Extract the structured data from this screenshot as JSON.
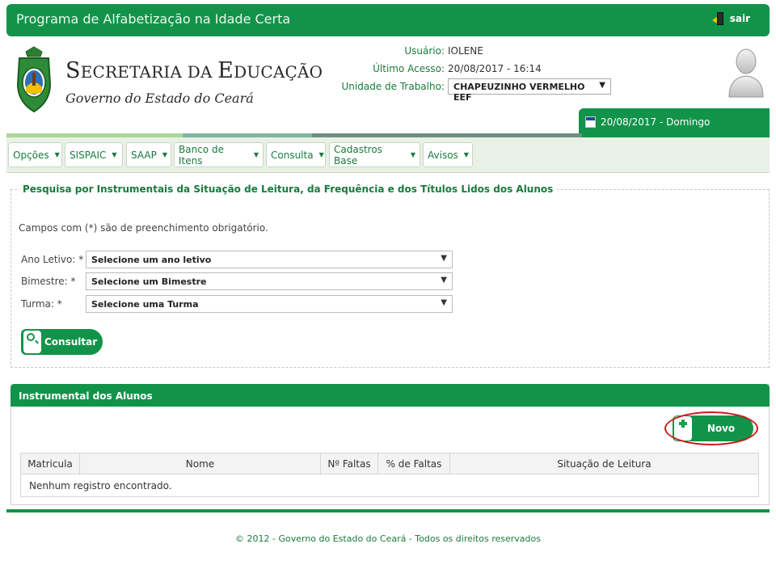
{
  "topbar": {
    "title": "Programa de Alfabetização na Idade Certa",
    "logout_label": "sair"
  },
  "brand": {
    "line1_big_a": "S",
    "line1_rest_a": "ECRETARIA ",
    "line1_small": "DA ",
    "line1_big_b": "E",
    "line1_rest_b": "DUCAÇÃO",
    "line2": "Governo do Estado do Ceará"
  },
  "user": {
    "user_label": "Usuário:",
    "user_value": "IOLENE",
    "last_access_label": "Último Acesso:",
    "last_access_value": "20/08/2017 - 16:14",
    "unit_label": "Unidade de Trabalho:",
    "unit_value": "CHAPEUZINHO VERMELHO EEF"
  },
  "date_badge": "20/08/2017 - Domingo",
  "nav": [
    {
      "label": "Opções"
    },
    {
      "label": "SISPAIC"
    },
    {
      "label": "SAAP"
    },
    {
      "label": "Banco de Itens"
    },
    {
      "label": "Consulta"
    },
    {
      "label": "Cadastros Base"
    },
    {
      "label": "Avisos"
    }
  ],
  "search": {
    "legend": "Pesquisa por Instrumentais da Situação de Leitura, da Frequência e dos Títulos Lidos dos Alunos",
    "required_note": "Campos com (*) são de preenchimento obrigatório.",
    "fields": [
      {
        "label": "Ano Letivo: *",
        "value": "Selecione um ano letivo"
      },
      {
        "label": "Bimestre: *",
        "value": "Selecione um Bimestre"
      },
      {
        "label": "Turma: *",
        "value": "Selecione uma Turma"
      }
    ],
    "submit_label": "Consultar"
  },
  "results": {
    "title": "Instrumental dos Alunos",
    "new_label": "Novo",
    "columns": [
      "Matricula",
      "Nome",
      "Nº Faltas",
      "% de Faltas",
      "Situação de Leitura"
    ],
    "empty_message": "Nenhum registro encontrado."
  },
  "footer": "© 2012 - Governo do Estado do Ceará - Todos os direitos reservados",
  "colors": {
    "brand_green": "#12934a",
    "highlight_red": "#cc1a1a"
  }
}
